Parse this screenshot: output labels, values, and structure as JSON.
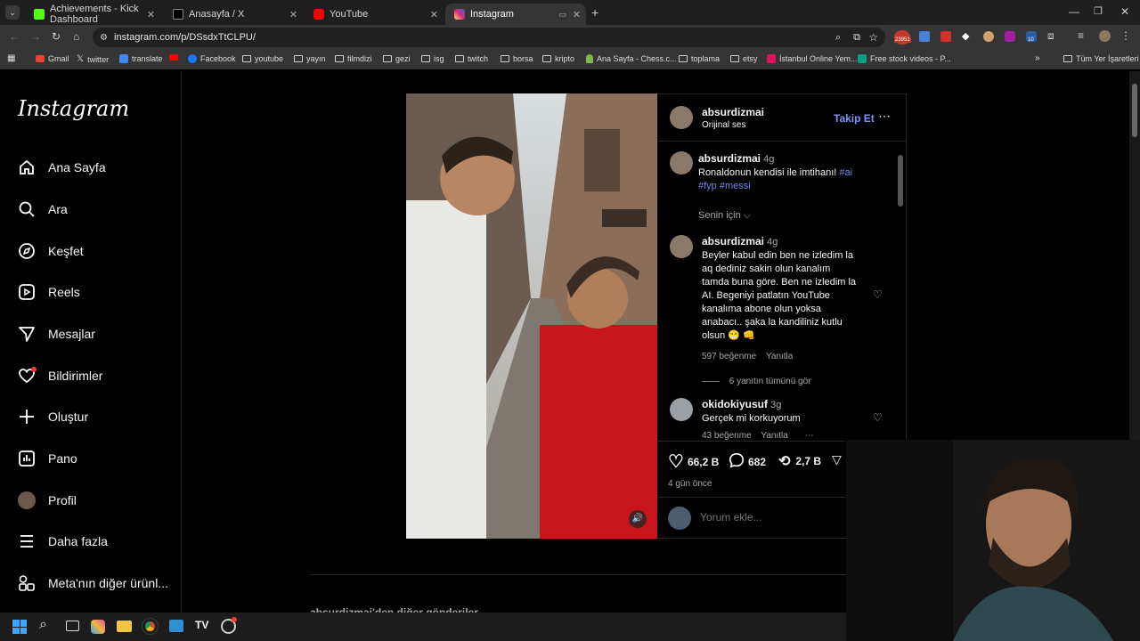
{
  "browser": {
    "tabs": [
      {
        "label": "Achievements - Kick Dashboard",
        "color": "#53fc18"
      },
      {
        "label": "Anasayfa / X",
        "color": "#000000"
      },
      {
        "label": "YouTube",
        "color": "#ff0000"
      },
      {
        "label": "Instagram",
        "color": "#d62976"
      }
    ],
    "url": "instagram.com/p/DSsdxTtCLPU/",
    "bookmarks": [
      "Gmail",
      "twitter",
      "translate",
      "",
      "Facebook",
      "youtube",
      "yayın",
      "filmdizi",
      "gezi",
      "isg",
      "twitch",
      "borsa",
      "kripto",
      "Ana Sayfa - Chess.c...",
      "toplama",
      "etsy",
      "İstanbul Online Yem...",
      "Free stock videos - P...",
      "Tüm Yer İşaretleri"
    ],
    "extension_badges": {
      "mail": "23951",
      "ext10": "10"
    }
  },
  "sidebar": {
    "logo": "Instagram",
    "items": [
      {
        "label": "Ana Sayfa",
        "icon": "home-icon"
      },
      {
        "label": "Ara",
        "icon": "search-icon"
      },
      {
        "label": "Keşfet",
        "icon": "compass-icon"
      },
      {
        "label": "Reels",
        "icon": "reels-icon"
      },
      {
        "label": "Mesajlar",
        "icon": "send-icon"
      },
      {
        "label": "Bildirimler",
        "icon": "heart-icon"
      },
      {
        "label": "Oluştur",
        "icon": "plus-icon"
      },
      {
        "label": "Pano",
        "icon": "dashboard-icon"
      },
      {
        "label": "Profil",
        "icon": "avatar-icon"
      },
      {
        "label": "Daha fazla",
        "icon": "menu-icon"
      },
      {
        "label": "Meta'nın diğer ürünl...",
        "icon": "meta-apps-icon"
      }
    ]
  },
  "post": {
    "author": "absurdizmai",
    "audio": "Orijinal ses",
    "follow": "Takip Et",
    "caption": {
      "user": "absurdizmai",
      "time": "4g",
      "text": "Ronaldonun kendisi ile imtihanı!",
      "tags": [
        "#ai",
        "#fyp",
        "#messi"
      ]
    },
    "filter": "Senin için",
    "comments": [
      {
        "user": "absurdizmai",
        "time": "4g",
        "lines": [
          "Beyler kabul edin ben ne izledim la",
          "aq dediniz sakin olun kanalım",
          "tamda buna göre. Ben ne izledim la",
          "AI. Begeniyi patlatın YouTube",
          "kanalıma abone olun yoksa",
          "anabacı.. şaka la kandiliniz kutlu",
          "olsun 😁 👊"
        ],
        "likes": "597 beğenme",
        "reply": "Yanıtla",
        "view_replies": "6 yanıtın tümünü gör"
      },
      {
        "user": "okidokiyusuf",
        "time": "3g",
        "text": "Gerçek mi korkuyorum",
        "likes": "43 beğenme",
        "reply": "Yanıtla"
      }
    ],
    "stats": {
      "likes": "66,2 B",
      "comments": "682",
      "reposts": "2,7 B"
    },
    "date": "4 gün önce",
    "comment_placeholder": "Yorum ekle...",
    "more_posts": "absurdizmai'den diğer gönderiler"
  }
}
